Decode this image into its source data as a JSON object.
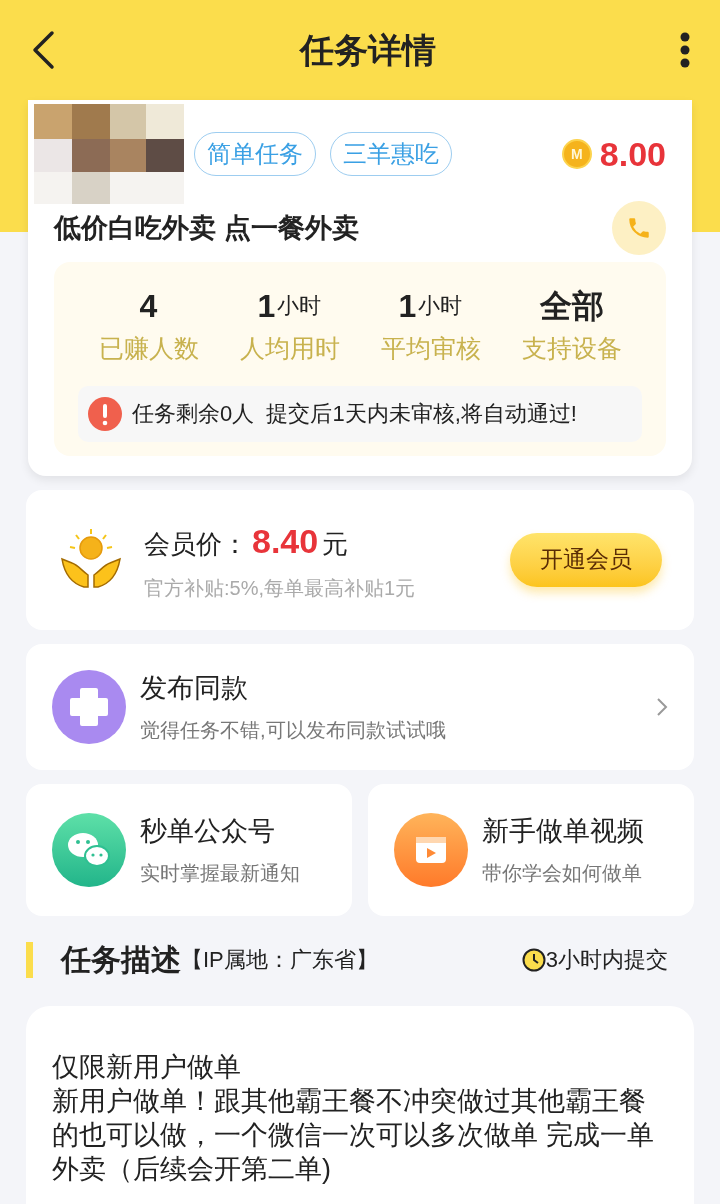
{
  "header": {
    "title": "任务详情"
  },
  "task": {
    "tags": [
      "简单任务",
      "三羊惠吃"
    ],
    "reward": "8.00",
    "coin": "M",
    "title": "低价白吃外卖 点一餐外卖",
    "stats": [
      {
        "value": "4",
        "label": "已赚人数"
      },
      {
        "value": "1",
        "unit": "小时",
        "label": "人均用时"
      },
      {
        "value": "1",
        "unit": "小时",
        "label": "平均审核"
      },
      {
        "value": "全部",
        "label": "支持设备"
      }
    ],
    "notice": "任务剩余0人  提交后1天内未审核,将自动通过!"
  },
  "member": {
    "label": "会员价：",
    "price": "8.40",
    "currency": "元",
    "note": "官方补贴:5%,每单最高补贴1元",
    "button": "开通会员"
  },
  "publish": {
    "title": "发布同款",
    "subtitle": "觉得任务不错,可以发布同款试试哦"
  },
  "cards": [
    {
      "kind": "wechat",
      "title": "秒单公众号",
      "subtitle": "实时掌握最新通知"
    },
    {
      "kind": "video",
      "title": "新手做单视频",
      "subtitle": "带你学会如何做单"
    }
  ],
  "description": {
    "title": "任务描述",
    "ip": "【IP属地：广东省】",
    "deadline": "3小时内提交",
    "lines": [
      "仅限新用户做单",
      "新用户做单！跟其他霸王餐不冲突做过其他霸王餐的也可以做，一个微信一次可以多次做单 完成一单外卖（后续会开第二单)"
    ]
  }
}
